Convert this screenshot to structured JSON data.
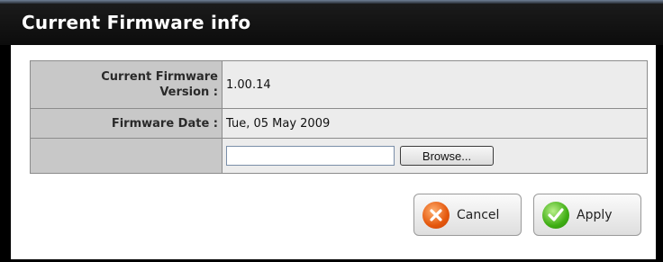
{
  "header": {
    "title": "Current Firmware info"
  },
  "firmware": {
    "version_label": "Current Firmware Version :",
    "version_label_line1": "Current Firmware",
    "version_label_line2": "Version :",
    "version_value": "1.00.14",
    "date_label": "Firmware Date :",
    "date_value": "Tue, 05 May 2009",
    "file_input_value": "",
    "browse_label": "Browse..."
  },
  "actions": {
    "cancel_label": "Cancel",
    "apply_label": "Apply",
    "cancel_icon": "cancel-x-icon",
    "apply_icon": "apply-check-icon"
  },
  "colors": {
    "header_bg": "#111111",
    "label_cell_bg": "#c8c8c8",
    "value_cell_bg": "#ececec",
    "cancel_icon": "#e4570c",
    "apply_icon": "#3fae14"
  }
}
